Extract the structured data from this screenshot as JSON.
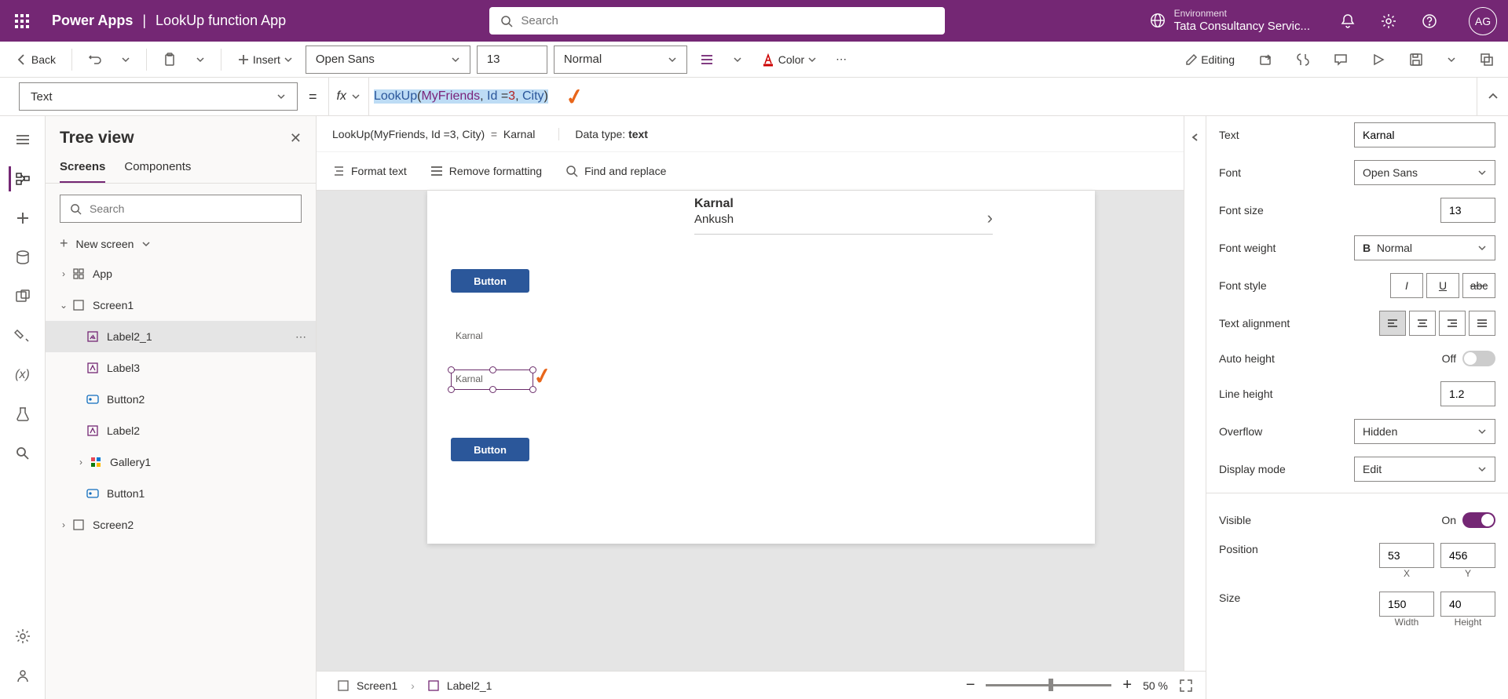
{
  "header": {
    "brand": "Power Apps",
    "appName": "LookUp function App",
    "searchPlaceholder": "Search",
    "envLabel": "Environment",
    "envValue": "Tata Consultancy Servic...",
    "avatar": "AG"
  },
  "ribbon": {
    "back": "Back",
    "insert": "Insert",
    "font": "Open Sans",
    "fontSize": "13",
    "weight": "Normal",
    "color": "Color",
    "editing": "Editing"
  },
  "propertyBar": {
    "property": "Text",
    "fx": "fx",
    "formulaParts": {
      "fn": "LookUp",
      "open": "(",
      "ds": "MyFriends",
      "c1": ", ",
      "id": "Id ",
      "eq": "=",
      "num": "3",
      "c2": ", ",
      "col": "City",
      "close": ")"
    }
  },
  "formulaResult": {
    "expr": "LookUp(MyFriends, Id =3, City)",
    "eq": "=",
    "value": "Karnal",
    "dtLabel": "Data type:",
    "dt": "text",
    "formatText": "Format text",
    "removeFmt": "Remove formatting",
    "findReplace": "Find and replace"
  },
  "tree": {
    "title": "Tree view",
    "tabScreens": "Screens",
    "tabComponents": "Components",
    "searchPlaceholder": "Search",
    "newScreen": "New screen",
    "items": [
      "App",
      "Screen1",
      "Label2_1",
      "Label3",
      "Button2",
      "Label2",
      "Gallery1",
      "Button1",
      "Screen2"
    ]
  },
  "canvas": {
    "galleryTitle": "Karnal",
    "gallerySub": "Ankush",
    "button1": "Button",
    "label1": "Karnal",
    "label2": "Karnal",
    "button2": "Button"
  },
  "props": {
    "text": {
      "label": "Text",
      "value": "Karnal"
    },
    "font": {
      "label": "Font",
      "value": "Open Sans"
    },
    "fontSize": {
      "label": "Font size",
      "value": "13"
    },
    "fontWeight": {
      "label": "Font weight",
      "value": "Normal"
    },
    "fontStyle": {
      "label": "Font style"
    },
    "textAlign": {
      "label": "Text alignment"
    },
    "autoHeight": {
      "label": "Auto height",
      "value": "Off"
    },
    "lineHeight": {
      "label": "Line height",
      "value": "1.2"
    },
    "overflow": {
      "label": "Overflow",
      "value": "Hidden"
    },
    "displayMode": {
      "label": "Display mode",
      "value": "Edit"
    },
    "visible": {
      "label": "Visible",
      "value": "On"
    },
    "position": {
      "label": "Position",
      "x": "53",
      "y": "456",
      "xl": "X",
      "yl": "Y"
    },
    "size": {
      "label": "Size",
      "w": "150",
      "h": "40",
      "wl": "Width",
      "hl": "Height"
    }
  },
  "statusBar": {
    "screen": "Screen1",
    "sel": "Label2_1",
    "zoom": "50",
    "pct": "%"
  }
}
